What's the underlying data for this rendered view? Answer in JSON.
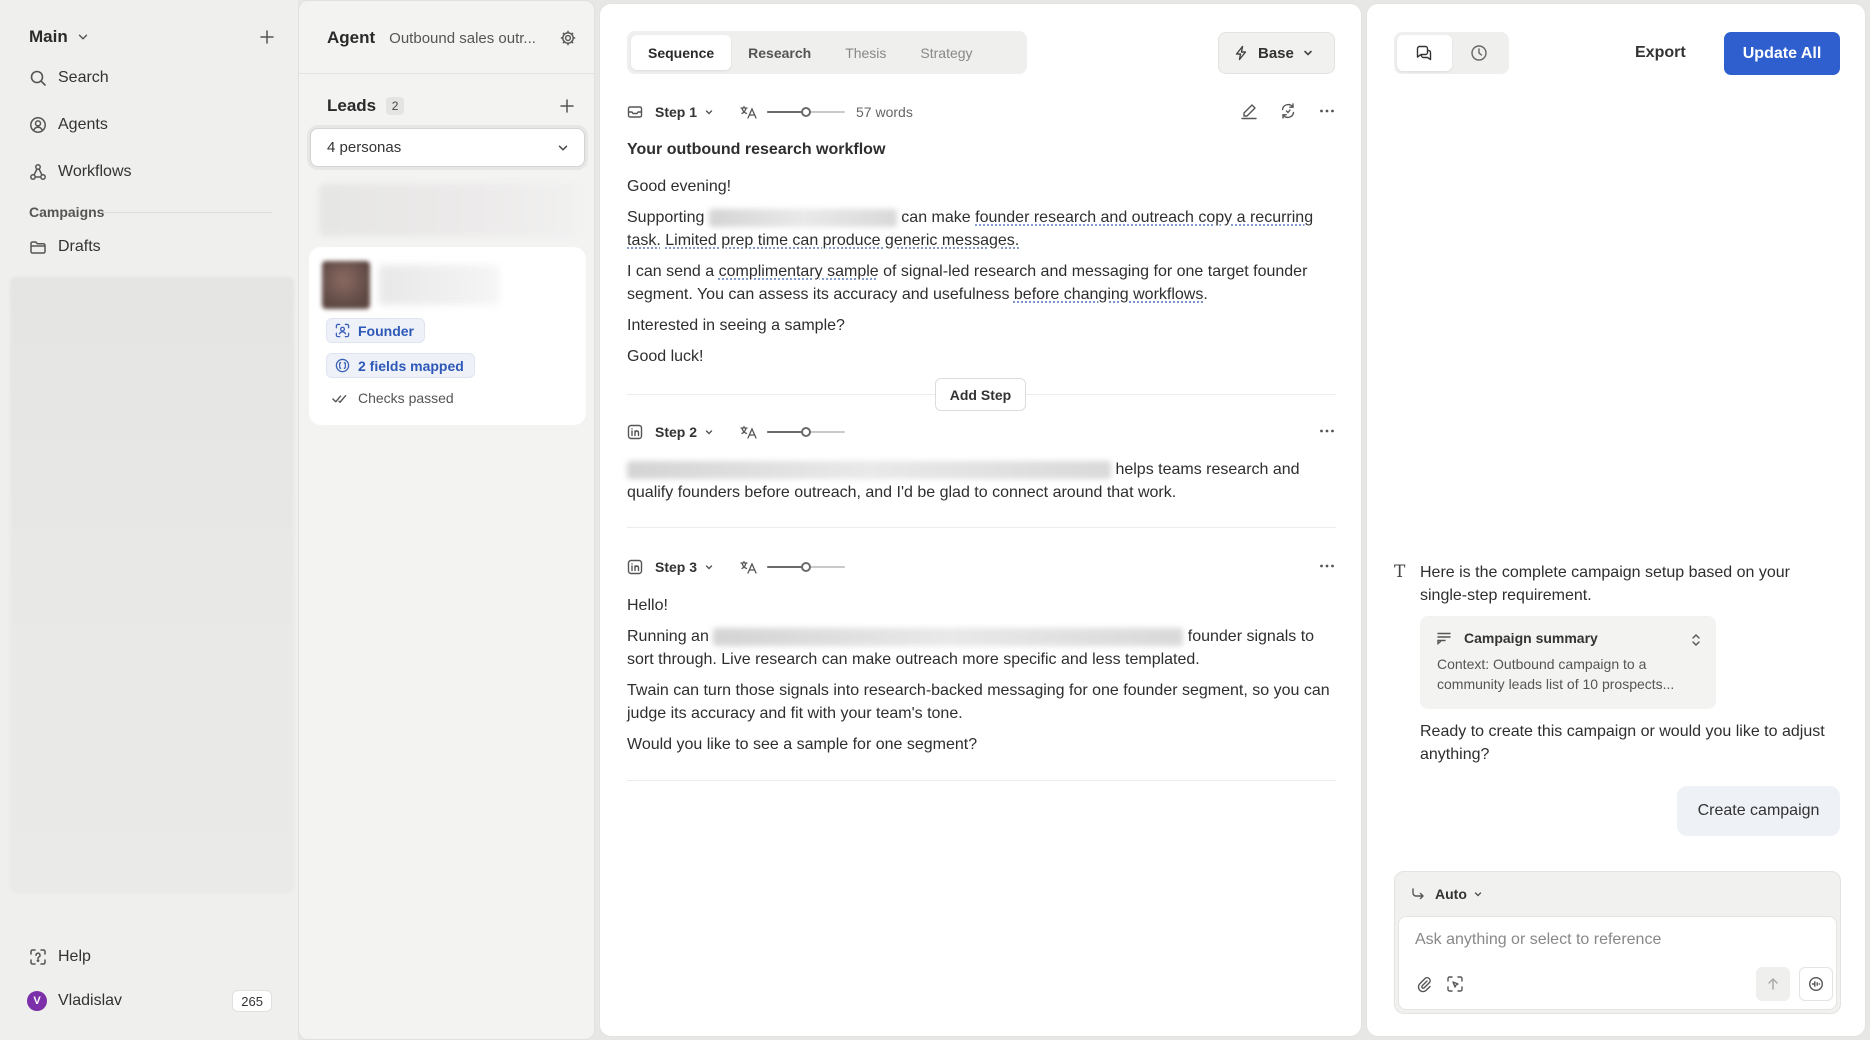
{
  "sidebar": {
    "workspace": "Main",
    "nav": [
      {
        "label": "Search",
        "icon": "search-icon"
      },
      {
        "label": "Agents",
        "icon": "agent-icon"
      },
      {
        "label": "Workflows",
        "icon": "workflow-icon"
      }
    ],
    "section": "Campaigns",
    "drafts": "Drafts",
    "help": "Help",
    "user": {
      "initial": "V",
      "name": "Vladislav",
      "credits": "265"
    }
  },
  "leads_panel": {
    "agent_label": "Agent",
    "agent_name": "Outbound sales outr...",
    "leads_label": "Leads",
    "leads_count": "2",
    "persona_select": "4 personas",
    "card": {
      "tag_role": "Founder",
      "tag_fields": "2 fields mapped",
      "checks": "Checks passed"
    }
  },
  "main": {
    "tabs": [
      "Sequence",
      "Research",
      "Thesis",
      "Strategy"
    ],
    "active_tab": 0,
    "mode": "Base",
    "add_step": "Add Step",
    "steps": [
      {
        "label": "Step 1",
        "channel": "email",
        "tone_level": 0.5,
        "words": "57 words",
        "heading": "Your outbound research workflow",
        "greeting": "Good evening!",
        "p1_pre": "Supporting",
        "p1_mid": "can make",
        "p1_link1": "founder research and outreach copy a recurring task.",
        "p1_link2": "Limited prep time can produce generic messages.",
        "p2_pre": "I can send a",
        "p2_link1": "complimentary sample",
        "p2_mid": "of signal-led research and messaging for one target founder segment. You can assess its accuracy and usefulness",
        "p2_link2": "before changing workflows",
        "p2_end": ".",
        "p3": "Interested in seeing a sample?",
        "signoff": "Good luck!"
      },
      {
        "label": "Step 2",
        "channel": "linkedin",
        "tone_level": 0.5,
        "text": "helps teams research and qualify founders before outreach, and I'd be glad to connect around that work."
      },
      {
        "label": "Step 3",
        "channel": "linkedin",
        "tone_level": 0.5,
        "greeting": "Hello!",
        "p1_pre": "Running an",
        "p1_post": "founder signals to sort through. Live research can make outreach more specific and less templated.",
        "p2": "Twain can turn those signals into research-backed messaging for one founder segment, so you can judge its accuracy and fit with your team's tone.",
        "p3": "Would you like to see a sample for one segment?"
      }
    ]
  },
  "chat": {
    "export": "Export",
    "update_all": "Update All",
    "message_1": "Here is the complete campaign setup based on your single-step requirement.",
    "summary_title": "Campaign summary",
    "summary_text": "Context: Outbound campaign to a community leads list of 10 prospects...",
    "message_2": "Ready to create this campaign or would you like to adjust anything?",
    "create_campaign": "Create campaign",
    "mode": "Auto",
    "input_placeholder": "Ask anything or select to reference"
  },
  "colors": {
    "accent": "#2f5fcf",
    "tag_text": "#2d58b8",
    "avatar": "#7b2fa8"
  }
}
